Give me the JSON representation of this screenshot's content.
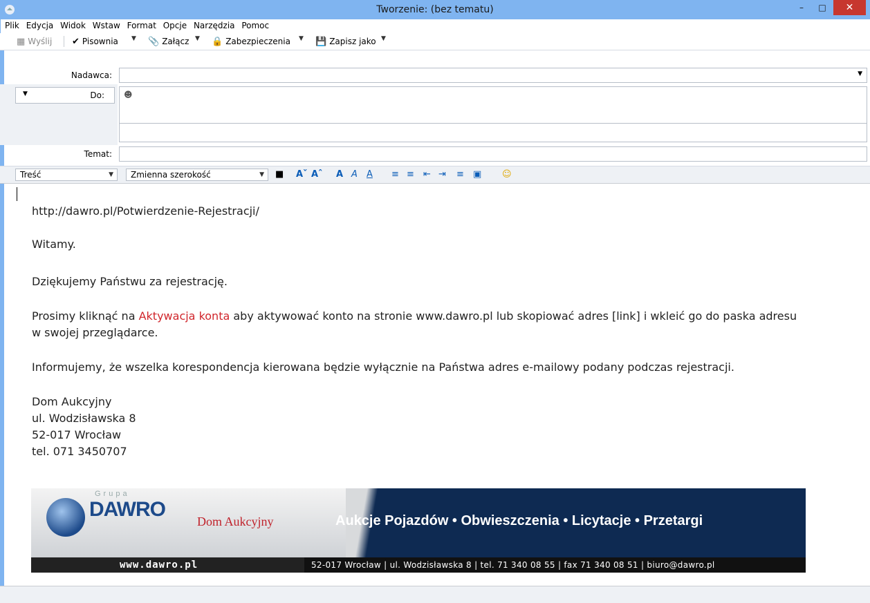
{
  "window": {
    "title": "Tworzenie: (bez tematu)"
  },
  "menu": [
    "Plik",
    "Edycja",
    "Widok",
    "Wstaw",
    "Format",
    "Opcje",
    "Narzędzia",
    "Pomoc"
  ],
  "toolbar": {
    "send": "Wyślij",
    "spelling": "Pisownia",
    "attach": "Załącz",
    "security": "Zabezpieczenia",
    "save_as": "Zapisz jako"
  },
  "header": {
    "from_label": "Nadawca:",
    "from_value": "",
    "to_label": "Do:",
    "to_value": "",
    "subject_label": "Temat:",
    "subject_value": ""
  },
  "format": {
    "paragraph_style": "Treść",
    "font": "Zmienna szerokość"
  },
  "body": {
    "url": "http://dawro.pl/Potwierdzenie-Rejestracji/",
    "greeting": "Witamy.",
    "thanks": "Dziękujemy Państwu za rejestrację.",
    "instr_pre": "Prosimy kliknąć na ",
    "instr_link": "Aktywacja konta",
    "instr_post": " aby aktywować konto na stronie www.dawro.pl lub skopiować adres [link] i wkleić go do paska adresu",
    "instr_line2": "w swojej przeglądarce.",
    "info": "Informujemy, że wszelka korespondencja kierowana będzie wyłącznie na Państwa adres e-mailowy podany podczas rejestracji.",
    "sig1": "Dom Aukcyjny",
    "sig2": "ul. Wodzisławska 8",
    "sig3": "52-017 Wrocław",
    "sig4": "tel. 071 3450707"
  },
  "banner": {
    "grupa": "Grupa",
    "brand": "DAWRO",
    "dom": "Dom Aukcyjny",
    "slogan": "Aukcje Pojazdów • Obwieszczenia • Licytacje • Przetargi",
    "www": "www.dawro.pl",
    "address": "52-017 Wrocław | ul. Wodzisławska 8 | tel. 71 340 08 55 | fax 71 340 08 51 | biuro@dawro.pl"
  },
  "colors": {
    "titlebar": "#7fb4f0",
    "close": "#c7372f",
    "link": "#d0252b",
    "banner": "#0e2a52"
  }
}
